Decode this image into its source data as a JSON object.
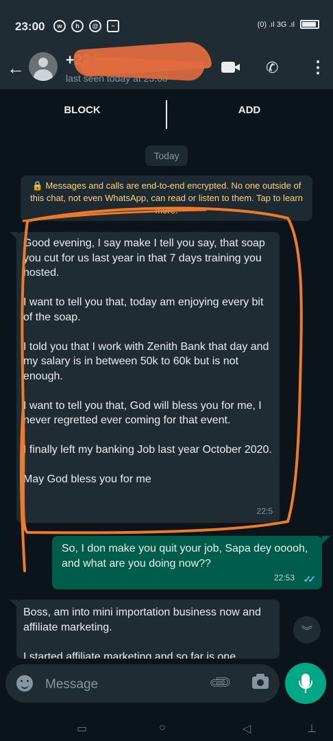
{
  "status_bar": {
    "time": "23:00",
    "left_icons": [
      "whatsapp-icon",
      "notification-icon",
      "at-icon",
      "activity-icon"
    ],
    "right_text": "(0) .ıl 3G .ıl"
  },
  "header": {
    "back_icon": "arrow-left-icon",
    "contact_name": "+234",
    "last_seen": "last seen today at 23:00",
    "actions": [
      "video-call-icon",
      "voice-call-icon",
      "more-vert-icon"
    ]
  },
  "block_bar": {
    "block_label": "BLOCK",
    "add_label": "ADD"
  },
  "day_chip": "Today",
  "encryption_notice": "🔒 Messages and calls are end-to-end encrypted. No one outside of this chat, not even WhatsApp, can read or listen to them. Tap to learn more.",
  "messages": [
    {
      "direction": "incoming",
      "paragraphs": [
        "Good evening, I say make I tell you say, that soap you cut for us last year in that 7 days training you hosted.",
        "I want to tell you that, today am enjoying every bit of the soap.",
        "I told you that I work with Zenith Bank that day and my salary is in between 50k to 60k but is not enough.",
        "I want to tell you that, God will bless you for me, I never regretted ever coming for that event.",
        "I finally left my banking Job last year October 2020.",
        "May God bless you for me"
      ],
      "time": "22:5"
    },
    {
      "direction": "outgoing",
      "text": "So, I don make you quit your job, Sapa dey ooooh, and what are you doing now??",
      "time": "22:53",
      "ticks": "✓✓"
    },
    {
      "direction": "incoming",
      "paragraphs": [
        "Boss, am into mini importation business now and affiliate marketing.",
        "I started affiliate marketing and so far is one"
      ]
    }
  ],
  "scroll_button_icon": "double-chevron-down-icon",
  "composer": {
    "placeholder": "Message",
    "emoji_icon": "emoji-icon",
    "attach_icon": "paperclip-icon",
    "camera_icon": "camera-icon",
    "mic_icon": "mic-icon"
  },
  "colors": {
    "background": "#0b141a",
    "bar": "#1f2c34",
    "outgoing_bubble": "#005c4b",
    "accent": "#00a884",
    "annotation": "#f07a28",
    "encryption_text": "#ffd279"
  }
}
